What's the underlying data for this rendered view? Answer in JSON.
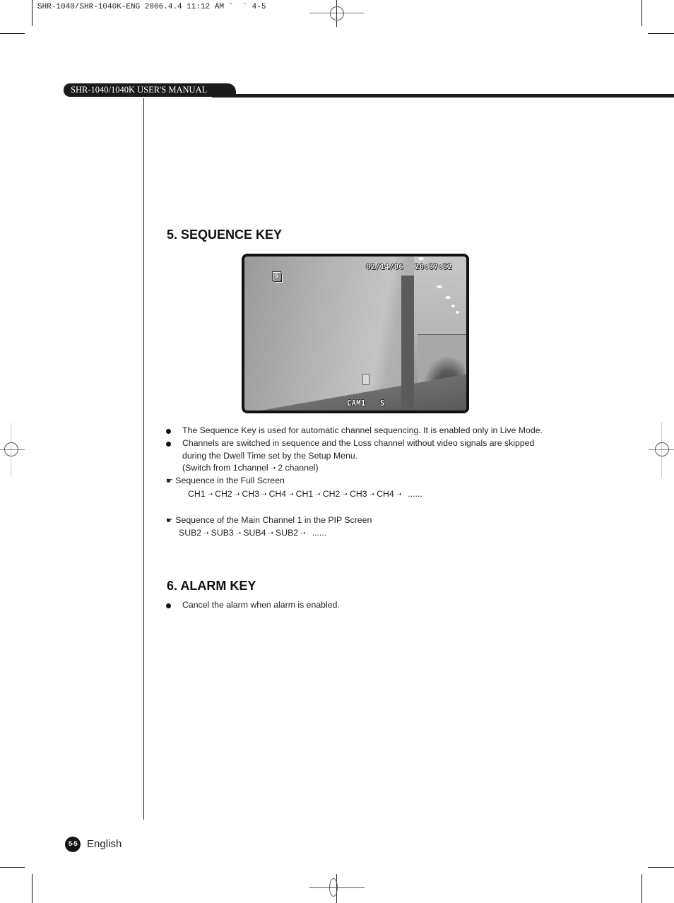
{
  "print_slug": "SHR-1040/SHR-1040K-ENG 2006.4.4 11:12 AM ˘  ` 4-5",
  "header": {
    "manual_title": "SHR-1040/1040K USER'S MANUAL"
  },
  "sections": [
    {
      "title": "5. SEQUENCE KEY",
      "camera_view": {
        "osd_date": "02/14/06",
        "osd_time": "20:37:52",
        "osd_camera": "CAM1",
        "osd_mode": "S",
        "sequence_icon_letter": "S"
      },
      "bullets": [
        "The Sequence Key is used for automatic channel sequencing. It is enabled only in Live Mode.",
        "Channels are switched in sequence and the Loss channel without video signals are skipped",
        "during the Dwell Time set by the Setup Menu."
      ],
      "switch_note": {
        "prefix": "(Switch from 1channel",
        "suffix": "2 channel)"
      },
      "full_screen": {
        "label": "Sequence in the Full Screen",
        "sequence": [
          "CH1",
          "CH2",
          "CH3",
          "CH4",
          "CH1",
          "CH2",
          "CH3",
          "CH4",
          "......"
        ]
      },
      "pip_screen": {
        "label": "Sequence of the Main Channel 1 in the PIP Screen",
        "sequence": [
          "SUB2",
          "SUB3",
          "SUB4",
          "SUB2",
          "......"
        ]
      }
    },
    {
      "title": "6. ALARM KEY",
      "bullets": [
        "Cancel the alarm when alarm is enabled."
      ]
    }
  ],
  "footer": {
    "page_number": "5-5",
    "language": "English"
  },
  "icons": {
    "bullet": "●",
    "pointing_hand": "☛",
    "arrow": "➝"
  }
}
